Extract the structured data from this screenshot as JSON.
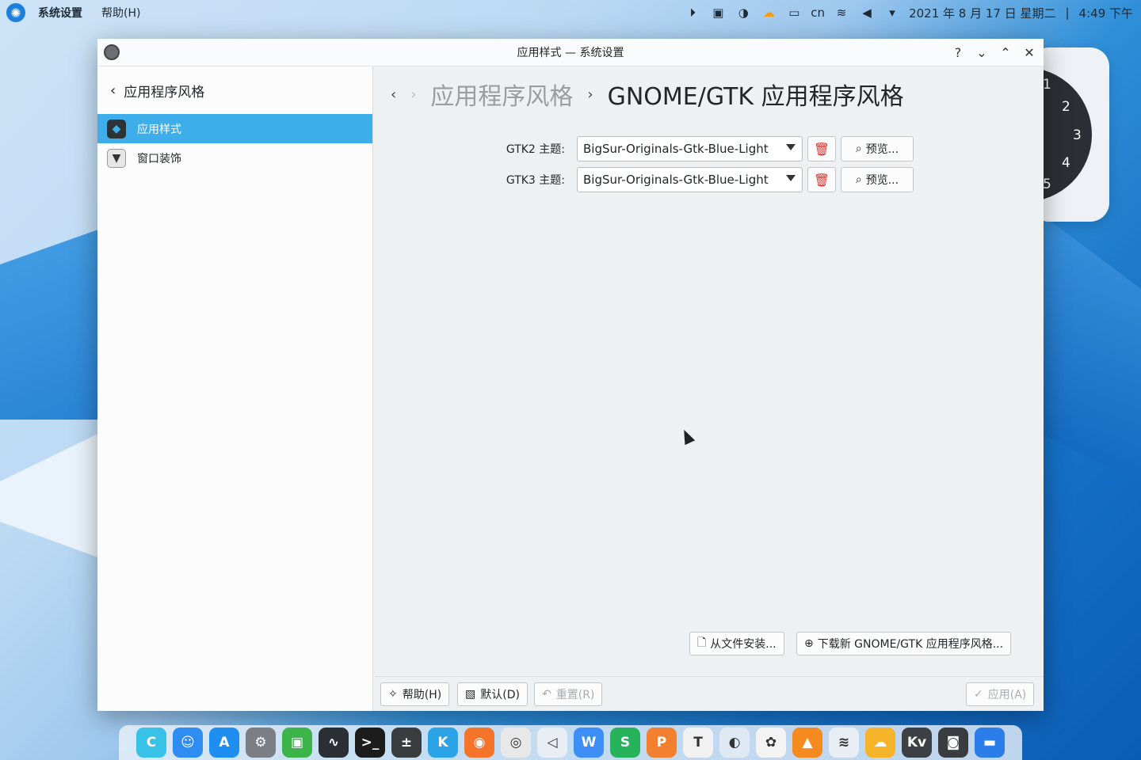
{
  "top_panel": {
    "app_name": "系统设置",
    "menu_help": "帮助(H)",
    "tray": {
      "lang": "cn",
      "datetime": "2021 年 8 月 17 日 星期二",
      "sep": "|",
      "time": "4:49 下午"
    }
  },
  "clock_widget": {
    "numbers": [
      "1",
      "2",
      "3",
      "4",
      "5"
    ]
  },
  "window": {
    "title": "应用样式 — 系统设置",
    "controls": {
      "help": "?",
      "minimize": "⌄",
      "maximize": "⌃",
      "close": "✕"
    },
    "sidebar": {
      "back_icon": "‹",
      "header": "应用程序风格",
      "items": [
        {
          "label": "应用样式",
          "icon": "cube-icon",
          "active": true
        },
        {
          "label": "窗口装饰",
          "icon": "tuxedo-icon",
          "active": false
        }
      ]
    },
    "breadcrumb": {
      "back": "‹",
      "forward": "›",
      "previous": "应用程序风格",
      "separator": "›",
      "current": "GNOME/GTK 应用程序风格"
    },
    "gtk2": {
      "label": "GTK2 主题:",
      "value": "BigSur-Originals-Gtk-Blue-Light",
      "preview": "预览..."
    },
    "gtk3": {
      "label": "GTK3 主题:",
      "value": "BigSur-Originals-Gtk-Blue-Light",
      "preview": "预览..."
    },
    "install_from_file": "从文件安装...",
    "download_new": "下载新 GNOME/GTK 应用程序风格...",
    "footer": {
      "help": "帮助(H)",
      "defaults": "默认(D)",
      "reset": "重置(R)",
      "apply": "应用(A)"
    }
  },
  "dock": {
    "apps": [
      {
        "name": "launcher-icon",
        "color": "#39c2e8",
        "glyph": "C"
      },
      {
        "name": "finder-icon",
        "color": "#2f8cf0",
        "glyph": "☺"
      },
      {
        "name": "app-store-icon",
        "color": "#1f8ef1",
        "glyph": "A"
      },
      {
        "name": "system-settings-icon",
        "color": "#7b7f83",
        "glyph": "⚙"
      },
      {
        "name": "task-manager-icon",
        "color": "#3bb54a",
        "glyph": "▣"
      },
      {
        "name": "system-monitor-icon",
        "color": "#2b2f33",
        "glyph": "∿"
      },
      {
        "name": "terminal-icon",
        "color": "#1c1c1c",
        "glyph": ">_"
      },
      {
        "name": "calculator-icon",
        "color": "#3a3d40",
        "glyph": "±"
      },
      {
        "name": "kdeconnect-icon",
        "color": "#2aa4e6",
        "glyph": "K"
      },
      {
        "name": "firefox-icon",
        "color": "#f5742a",
        "glyph": "◉"
      },
      {
        "name": "chrome-icon",
        "color": "#e8e8e8",
        "glyph": "◎"
      },
      {
        "name": "vscode-icon",
        "color": "#e9eef4",
        "glyph": "◁"
      },
      {
        "name": "wps-writer-icon",
        "color": "#3d8ef6",
        "glyph": "W"
      },
      {
        "name": "wps-sheets-icon",
        "color": "#27b35b",
        "glyph": "S"
      },
      {
        "name": "wps-presentation-icon",
        "color": "#f2802e",
        "glyph": "P"
      },
      {
        "name": "typora-icon",
        "color": "#f1f1f1",
        "glyph": "T"
      },
      {
        "name": "preview-icon",
        "color": "#dfe9f4",
        "glyph": "◐"
      },
      {
        "name": "photos-icon",
        "color": "#f3f3f3",
        "glyph": "✿"
      },
      {
        "name": "vlc-icon",
        "color": "#f58a1f",
        "glyph": "▲"
      },
      {
        "name": "kite-icon",
        "color": "#e8eef4",
        "glyph": "≋"
      },
      {
        "name": "cloud-drive-icon",
        "color": "#f5b42a",
        "glyph": "☁"
      },
      {
        "name": "kvantum-icon",
        "color": "#3c3f43",
        "glyph": "Kv"
      },
      {
        "name": "screenshot-icon",
        "color": "#3a3d40",
        "glyph": "◙"
      },
      {
        "name": "files-icon",
        "color": "#2b7de9",
        "glyph": "▬"
      }
    ]
  }
}
